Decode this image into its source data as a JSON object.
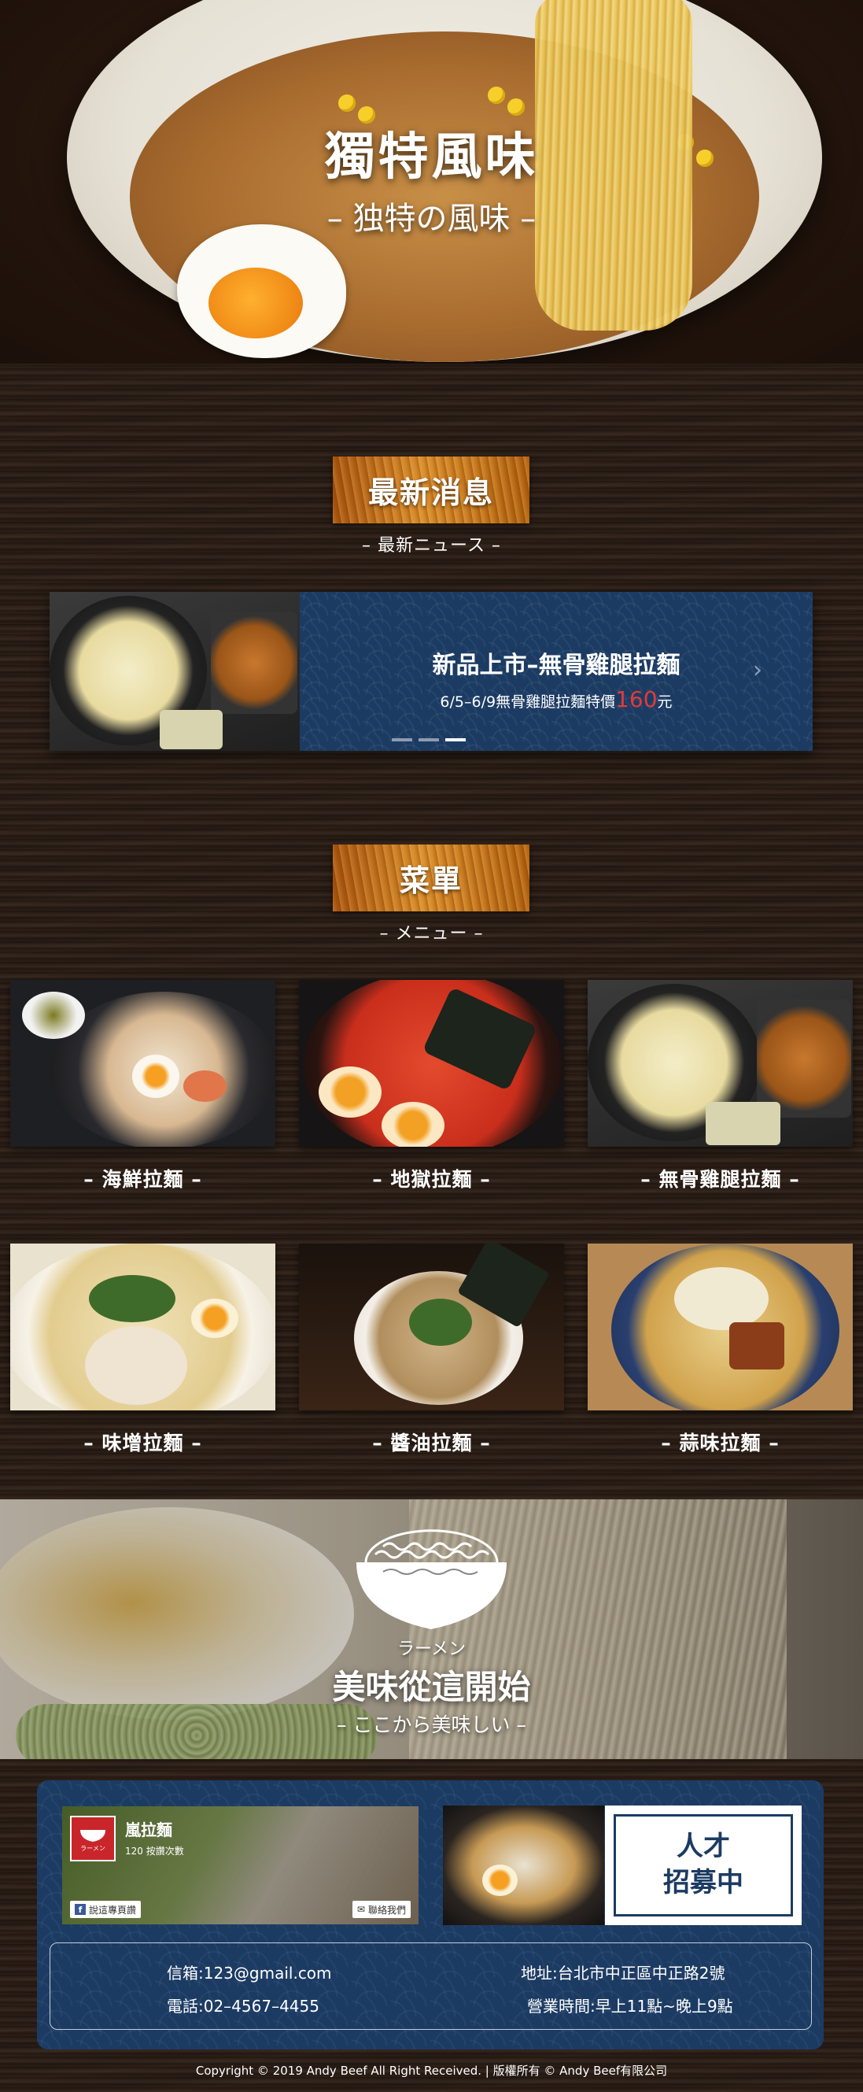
{
  "hero": {
    "title": "獨特風味",
    "subtitle": "– 独特の風味 –"
  },
  "news_section": {
    "heading": "最新消息",
    "subheading": "– 最新ニュース –",
    "item": {
      "title": "新品上市–無骨雞腿拉麵",
      "desc_prefix": "6/5–6/9無骨雞腿拉麵特價",
      "price": "160",
      "desc_suffix": "元",
      "next_icon": "chevron-right-icon",
      "slide_count": 3,
      "active_slide": 3
    }
  },
  "menu_section": {
    "heading": "菜單",
    "subheading": "– メニュー –",
    "items": [
      {
        "label": "– 海鮮拉麵 –"
      },
      {
        "label": "– 地獄拉麵 –"
      },
      {
        "label": "– 無骨雞腿拉麵 –"
      },
      {
        "label": "– 味增拉麵 –"
      },
      {
        "label": "– 醬油拉麵 –"
      },
      {
        "label": "– 蒜味拉麵 –"
      }
    ]
  },
  "banner": {
    "ramen_word": "ラーメン",
    "title": "美味從這開始",
    "subtitle": "– ここから美味しい –"
  },
  "footer": {
    "fb": {
      "name": "嵐拉麵",
      "views": "120 按讚次數",
      "logo_text": "ラーメン",
      "share_label": "說這專頁讚",
      "contact_label": "聯絡我們"
    },
    "hiring": {
      "line1": "人才",
      "line2": "招募中"
    },
    "contact": {
      "email": "信箱:123@gmail.com",
      "phone": "電話:02–4567–4455",
      "address": "地址:台北市中正區中正路2號",
      "hours": "營業時間:早上11點~晚上9點"
    },
    "copyright": "Copyright © 2019 Andy Beef All Right Received. | 版權所有 © Andy Beef有限公司"
  },
  "colors": {
    "navy": "#1c3b63",
    "price_red": "#e23a3a",
    "wood_label": "#c57a1c"
  }
}
